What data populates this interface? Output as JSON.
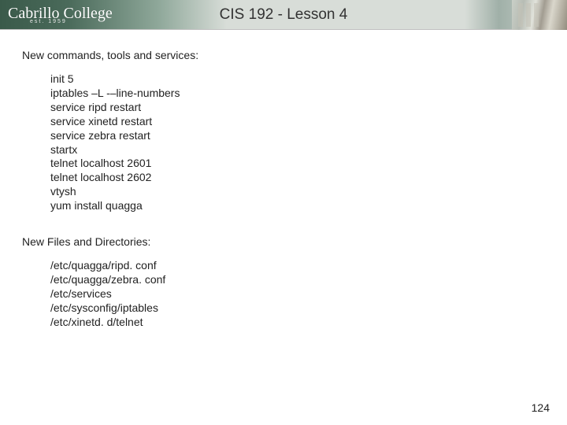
{
  "header": {
    "logo_main": "Cabrillo College",
    "logo_sub": "est. 1959",
    "title": "CIS 192 - Lesson 4"
  },
  "sections": {
    "commands": {
      "heading": "New commands, tools and services:",
      "items": [
        "init 5",
        "iptables –L -–line-numbers",
        "service ripd restart",
        "service xinetd restart",
        "service zebra restart",
        "startx",
        "telnet localhost 2601",
        "telnet localhost 2602",
        "vtysh",
        "yum install quagga"
      ]
    },
    "files": {
      "heading": "New Files and Directories:",
      "items": [
        "/etc/quagga/ripd. conf",
        "/etc/quagga/zebra. conf",
        "/etc/services",
        "/etc/sysconfig/iptables",
        "/etc/xinetd. d/telnet"
      ]
    }
  },
  "page_number": "124"
}
